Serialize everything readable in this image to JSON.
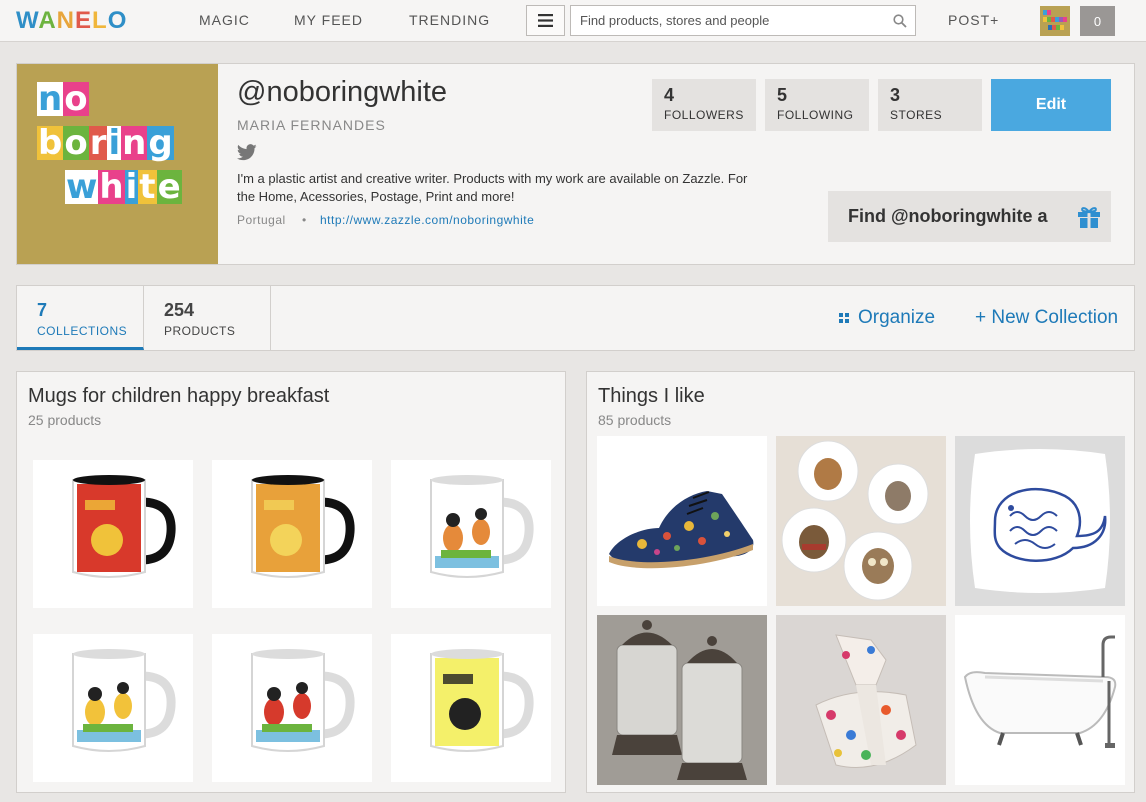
{
  "nav": {
    "logo": "WANELO",
    "logo_colors": [
      "#2f8fc7",
      "#6db33f",
      "#e8a53b",
      "#e05a4b",
      "#f0b63b",
      "#2f8fc7"
    ],
    "links": [
      "MAGIC",
      "MY FEED",
      "TRENDING"
    ],
    "menu_icon": "hamburger-icon",
    "search_placeholder": "Find products, stores and people",
    "search_icon": "search-icon",
    "post_label": "POST+",
    "notification_count": "0"
  },
  "profile": {
    "image_lines": [
      [
        "n",
        "o"
      ],
      [
        "b",
        "o",
        "r",
        "i",
        "n",
        "g"
      ],
      [
        "w",
        "h",
        "i",
        "t",
        "e"
      ]
    ],
    "handle": "@noboringwhite",
    "real_name": "MARIA FERNANDES",
    "twitter_icon": "twitter-icon",
    "bio": "I'm a plastic artist and creative writer. Products with my work are available on Zazzle. For the Home, Acessories, Postage, Print and more!",
    "location": "Portugal",
    "separator": "•",
    "website": "http://www.zazzle.com/noboringwhite",
    "stats": [
      {
        "num": "4",
        "label": "FOLLOWERS"
      },
      {
        "num": "5",
        "label": "FOLLOWING"
      },
      {
        "num": "3",
        "label": "STORES"
      }
    ],
    "edit_label": "Edit",
    "find_label": "Find @noboringwhite a",
    "gift_icon": "gift-icon"
  },
  "tabs": [
    {
      "num": "7",
      "label": "COLLECTIONS"
    },
    {
      "num": "254",
      "label": "PRODUCTS"
    }
  ],
  "actions": {
    "organize_label": "Organize",
    "new_collection_label": "+ New Collection"
  },
  "collections": [
    {
      "title": "Mugs for children happy breakfast",
      "count": "25 products",
      "mugs": [
        {
          "bg": "#d8392b",
          "accent": "#f0c23a",
          "rim": "#111111",
          "subject": "monster"
        },
        {
          "bg": "#e8a13a",
          "accent": "#f3d35a",
          "rim": "#111111",
          "subject": "halloween"
        },
        {
          "bg": "#ffffff",
          "accent": "#e58a3a",
          "rim": "#dcdcdc",
          "subject": "ants"
        },
        {
          "bg": "#ffffff",
          "accent": "#f2c23a",
          "rim": "#dcdcdc",
          "subject": "bees"
        },
        {
          "bg": "#ffffff",
          "accent": "#d63a2c",
          "rim": "#dcdcdc",
          "subject": "ladybugs"
        },
        {
          "bg": "#f4f06a",
          "accent": "#222222",
          "rim": "#dcdcdc",
          "subject": "girl"
        }
      ]
    },
    {
      "title": "Things I like",
      "count": "85 products",
      "items": [
        {
          "subject": "floral-shoe",
          "bg": "#ffffff"
        },
        {
          "subject": "animal-plates",
          "bg": "#e6dfd6"
        },
        {
          "subject": "whale-pillow",
          "bg": "#ececec"
        },
        {
          "subject": "glass-jars",
          "bg": "#a8a49d"
        },
        {
          "subject": "pompom-sandal",
          "bg": "#dad6d3"
        },
        {
          "subject": "bathtub",
          "bg": "#ffffff"
        }
      ]
    }
  ],
  "colors": {
    "accent": "#1e7ab8",
    "edit_button": "#4aa8e0",
    "profile_image_bg": "#b9a153"
  }
}
